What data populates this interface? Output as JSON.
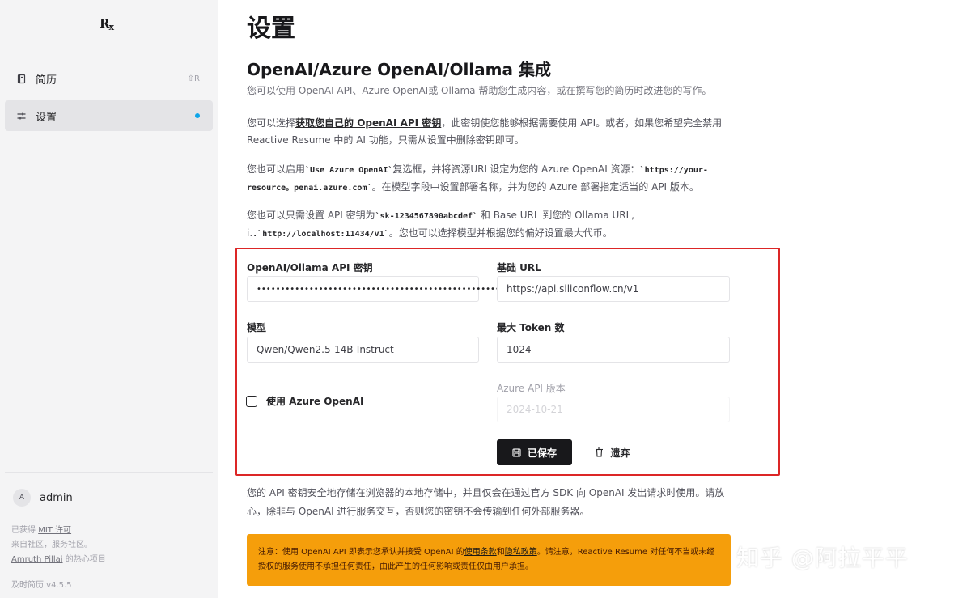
{
  "sidebar": {
    "logo": "Rx",
    "items": [
      {
        "label": "简历",
        "shortcut": "⇧R",
        "icon": "notebook-icon"
      },
      {
        "label": "设置",
        "icon": "sliders-icon",
        "active": true
      }
    ],
    "user": {
      "initial": "A",
      "name": "admin"
    },
    "footer": {
      "line1_prefix": "已获得 ",
      "line1_link": "MIT 许可",
      "line2": "来自社区，服务社区。",
      "line3_link": "Amruth Pillai",
      "line3_suffix": " 的热心项目",
      "version": "及时简历 v4.5.5"
    }
  },
  "main": {
    "page_title": "设置",
    "section_title": "OpenAI/Azure OpenAI/Ollama 集成",
    "subtitle": "您可以使用 OpenAI API、Azure OpenAI或 Ollama 帮助您生成内容，或在撰写您的简历时改进您的写作。",
    "para1_a": "您可以选择",
    "para1_link": "获取您自己的 OpenAI API 密钥",
    "para1_b": "，此密钥使您能够根据需要使用 API。或者，如果您希望完全禁用 Reactive Resume 中的 AI 功能，只需从设置中删除密钥即可。",
    "para2_a": "您也可以启用",
    "para2_code1": "`Use Azure OpenAI`",
    "para2_b": "复选框，并将资源URL设定为您的 Azure OpenAI 资源：",
    "para2_code2": "`https://your-resource。penai.azure.com`",
    "para2_c": "。在模型字段中设置部署名称，并为您的 Azure 部署指定适当的 API 版本。",
    "para3_a": "您也可以只需设置 API 密钥为",
    "para3_code1": "`sk-1234567890abcdef`",
    "para3_b": " 和 Base URL 到您的 Ollama URL, i.",
    "para3_code2": ".`http://localhost:11434/v1`",
    "para3_c": "。您也可以选择模型并根据您的偏好设置最大代币。"
  },
  "form": {
    "api_key_label": "OpenAI/Ollama API 密钥",
    "api_key_value": "••••••••••••••••••••••••••••••••••••••••••••••••••••",
    "base_url_label": "基础 URL",
    "base_url_value": "https://api.siliconflow.cn/v1",
    "model_label": "模型",
    "model_value": "Qwen/Qwen2.5-14B-Instruct",
    "max_tokens_label": "最大 Token 数",
    "max_tokens_value": "1024",
    "azure_checkbox_label": "使用 Azure OpenAI",
    "azure_checked": false,
    "azure_version_label": "Azure API 版本",
    "azure_version_value": "2024-10-21",
    "saved_button": "已保存",
    "discard_button": "遗弃"
  },
  "privacy_text": "您的 API 密钥安全地存储在浏览器的本地存储中，并且仅会在通过官方 SDK 向 OpenAI 发出请求时使用。请放心，除非与 OpenAI 进行服务交互，否则您的密钥不会传输到任何外部服务器。",
  "notice": {
    "a": "注意：使用 OpenAI API 即表示您承认并接受 OpenAI 的",
    "terms": "使用条款",
    "and": "和",
    "privacy": "隐私政策",
    "b": "。请注意，Reactive Resume 对任何不当或未经授权的服务使用不承担任何责任，由此产生的任何影响或责任仅由用户承担。"
  },
  "watermark": "知乎 @阿拉平平",
  "colors": {
    "accent_dot": "#0ea5e9",
    "highlight_border": "#dc2626",
    "notice_bg": "#f59e0b",
    "primary_button": "#18181b"
  }
}
